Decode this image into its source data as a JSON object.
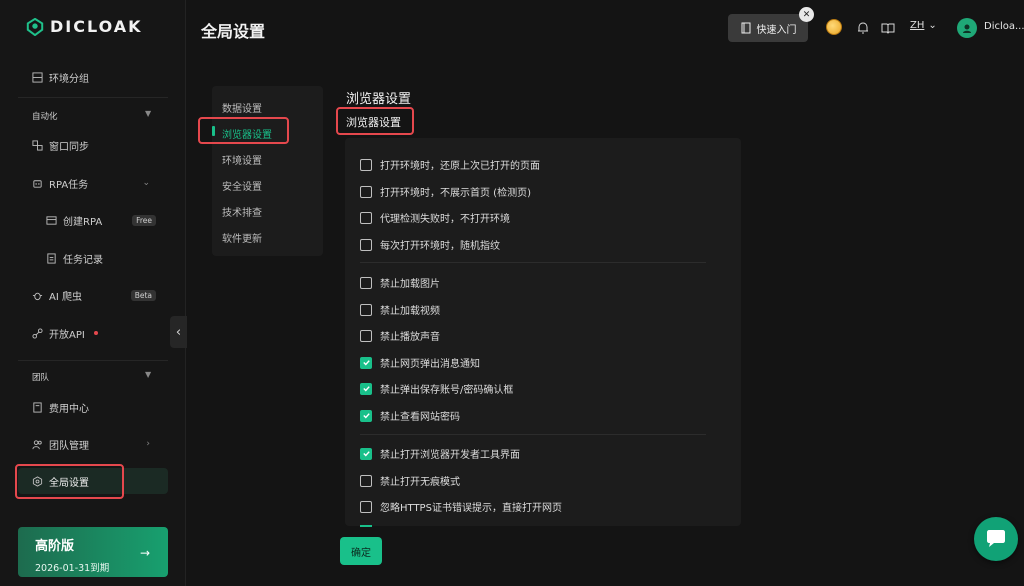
{
  "brand": {
    "name": "DICLOAK"
  },
  "sidebar": {
    "env_group": "环境分组",
    "automation_label": "自动化",
    "window_sync": "窗口同步",
    "rpa_tasks": "RPA任务",
    "create_rpa": "创建RPA",
    "create_rpa_badge": "Free",
    "task_records": "任务记录",
    "ai_crawler": "AI 爬虫",
    "ai_crawler_badge": "Beta",
    "open_api": "开放API",
    "team_label": "团队",
    "billing": "费用中心",
    "team_manage": "团队管理",
    "global_settings": "全局设置"
  },
  "plan": {
    "title": "高阶版",
    "expiry": "2026-01-31到期",
    "arrow": "→"
  },
  "header": {
    "title": "全局设置",
    "quick_start": "快速入门",
    "language": "ZH",
    "user": "Dicloa..."
  },
  "settings_nav": [
    "数据设置",
    "浏览器设置",
    "环境设置",
    "安全设置",
    "技术排查",
    "软件更新"
  ],
  "content": {
    "title": "浏览器设置",
    "subtitle": "浏览器设置",
    "options": [
      {
        "label": "打开环境时，还原上次已打开的页面",
        "checked": false
      },
      {
        "label": "打开环境时，不展示首页 (检测页)",
        "checked": false
      },
      {
        "label": "代理检测失败时，不打开环境",
        "checked": false
      },
      {
        "label": "每次打开环境时，随机指纹",
        "checked": false
      },
      {
        "label": "禁止加载图片",
        "checked": false
      },
      {
        "label": "禁止加载视频",
        "checked": false
      },
      {
        "label": "禁止播放声音",
        "checked": false
      },
      {
        "label": "禁止网页弹出消息通知",
        "checked": true
      },
      {
        "label": "禁止弹出保存账号/密码确认框",
        "checked": true
      },
      {
        "label": "禁止查看网站密码",
        "checked": true
      },
      {
        "label": "禁止打开浏览器开发者工具界面",
        "checked": true
      },
      {
        "label": "禁止打开无痕模式",
        "checked": false
      },
      {
        "label": "忽略HTTPS证书错误提示，直接打开网页",
        "checked": false
      }
    ],
    "confirm": "确定"
  },
  "colors": {
    "accent": "#19c08a",
    "highlight": "#e5484d"
  }
}
